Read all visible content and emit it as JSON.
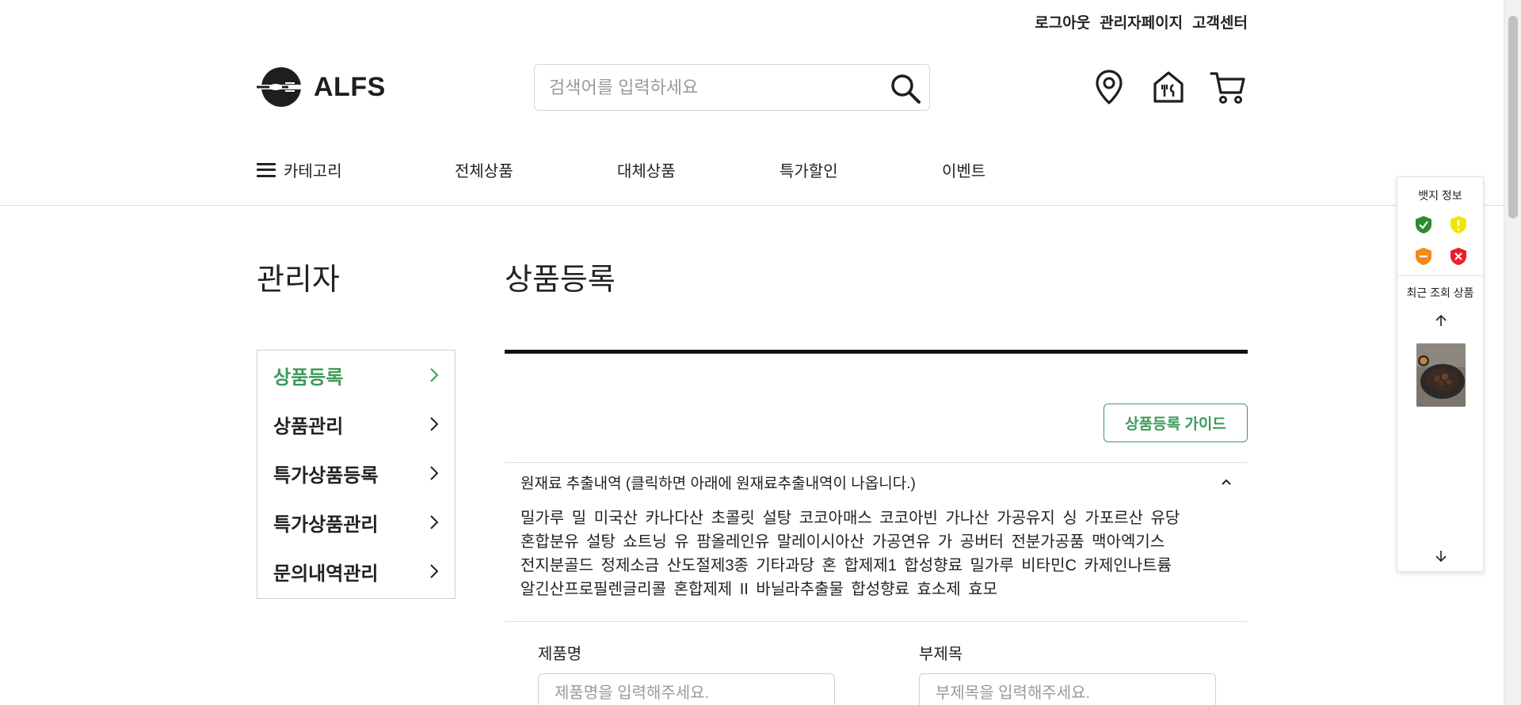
{
  "top_links": [
    "로그아웃",
    "관리자페이지",
    "고객센터"
  ],
  "logo": {
    "text": "ALFS"
  },
  "search": {
    "placeholder": "검색어를 입력하세요",
    "value": ""
  },
  "header_icons": [
    "location-pin-icon",
    "store-icon",
    "cart-icon"
  ],
  "nav": {
    "category_label": "카테고리",
    "items": [
      "전체상품",
      "대체상품",
      "특가할인",
      "이벤트"
    ]
  },
  "sidebar": {
    "title": "관리자",
    "items": [
      "상품등록",
      "상품관리",
      "특가상품등록",
      "특가상품관리",
      "문의내역관리"
    ],
    "active_index": 0
  },
  "main": {
    "title": "상품등록",
    "guide_button": "상품등록 가이드",
    "accordion": {
      "header": "원재료 추출내역 (클릭하면 아래에 원재료추출내역이 나옵니다.)",
      "lines": [
        "밀가루 밀 미국산 카나다산 초콜릿 설탕 코코아매스 코코아빈 가나산 가공유지 싱 가포르산 유당",
        "혼합분유 설탕 쇼트닝 유 팜올레인유 말레이시아산 가공연유 가 공버터 전분가공품 맥아엑기스",
        "전지분골드 정제소금 산도절제3종 기타과당 혼 합제제1 합성향료 밀가루 비타민C 카제인나트륨",
        "알긴산프로필렌글리콜 혼합제제 II 바닐라추출물 합성향료 효소제 효모"
      ]
    },
    "fields": {
      "product_name_label": "제품명",
      "product_name_placeholder": "제품명을 입력해주세요.",
      "subtitle_label": "부제목",
      "subtitle_placeholder": "부제목을 입력해주세요."
    }
  },
  "float_panel": {
    "badge_title": "뱃지 정보",
    "recent_title": "최근 조회 상품",
    "badges": [
      {
        "name": "check",
        "color": "#2e8b2e"
      },
      {
        "name": "warning",
        "color": "#f2e600"
      },
      {
        "name": "minus",
        "color": "#f08a1a"
      },
      {
        "name": "x",
        "color": "#e8202a"
      }
    ]
  },
  "colors": {
    "accent": "#3c9a5b",
    "text": "#222222"
  }
}
